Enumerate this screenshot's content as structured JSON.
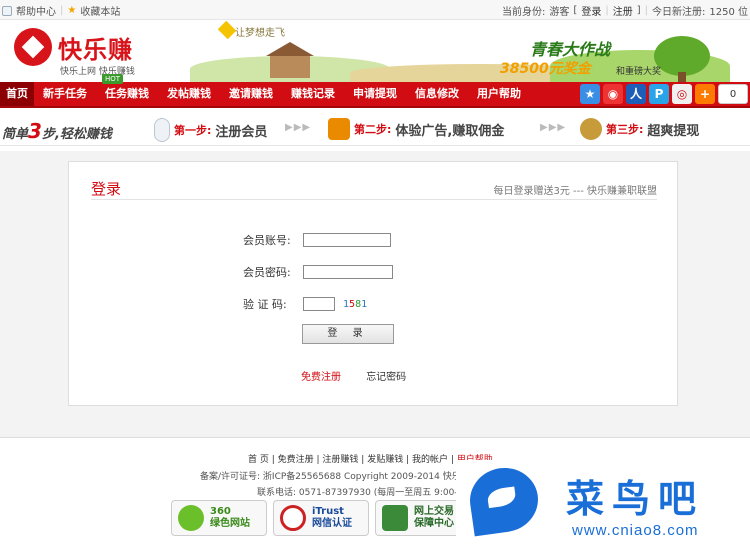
{
  "topbar": {
    "help": "帮助中心",
    "bookmark": "收藏本站",
    "identity_label": "当前身份:",
    "identity_value": "游客",
    "bracket_open": "[",
    "login": "登录",
    "separator": "|",
    "register": "注册",
    "bracket_close": "]",
    "today_label": "今日新注册:",
    "today_value": "1250 位"
  },
  "header": {
    "logo_text": "快乐赚",
    "logo_sub": "快乐上网 快乐赚钱",
    "slogan": "让梦想走飞",
    "promo_title": "青春大作战",
    "promo_amount": "38500元奖金",
    "promo_sub": "和重磅大奖"
  },
  "nav": {
    "items": [
      "首页",
      "新手任务",
      "任务赚钱",
      "发帖赚钱",
      "邀请赚钱",
      "赚钱记录",
      "申请提现",
      "信息修改",
      "用户帮助"
    ],
    "hot": "HOT",
    "share_count": "0"
  },
  "steps": {
    "lead_pre": "简单",
    "lead_num": "3",
    "lead_post": "步,轻松赚钱",
    "s1_label": "第一步:",
    "s1_text": "注册会员",
    "s2_label": "第二步:",
    "s2_text": "体验广告,赚取佣金",
    "s3_label": "第三步:",
    "s3_text": "超爽提现",
    "arrows": "▶▶▶"
  },
  "login": {
    "title": "登录",
    "note": "每日登录赠送3元 --- 快乐赚兼职联盟",
    "account_label": "会员账号:",
    "password_label": "会员密码:",
    "captcha_label": "验 证 码:",
    "captcha_code": [
      "1",
      "5",
      "8",
      "1"
    ],
    "submit": "登 录",
    "free_register": "免费注册",
    "forgot": "忘记密码"
  },
  "footer": {
    "links": [
      "首 页",
      "免费注册",
      "注册赚钱",
      "发贴赚钱",
      "我的帐户"
    ],
    "help": "用户帮助",
    "icp": "备案/许可证号: 浙ICP备25565688   Copyright 2009-2014 快乐",
    "phone": "联系电话: 0571-87397930 (每周一至周五 9:00-",
    "badges": [
      {
        "l1": "360",
        "l2": "绿色网站"
      },
      {
        "l1": "iTrust",
        "l2": "网信认证"
      },
      {
        "l1": "网上交易",
        "l2": "保障中心"
      }
    ]
  },
  "watermark": {
    "text": "菜鸟吧",
    "url": "www.cniao8.com"
  },
  "colors": {
    "brand_red": "#d10d13",
    "watermark_blue": "#1a6ed8"
  }
}
